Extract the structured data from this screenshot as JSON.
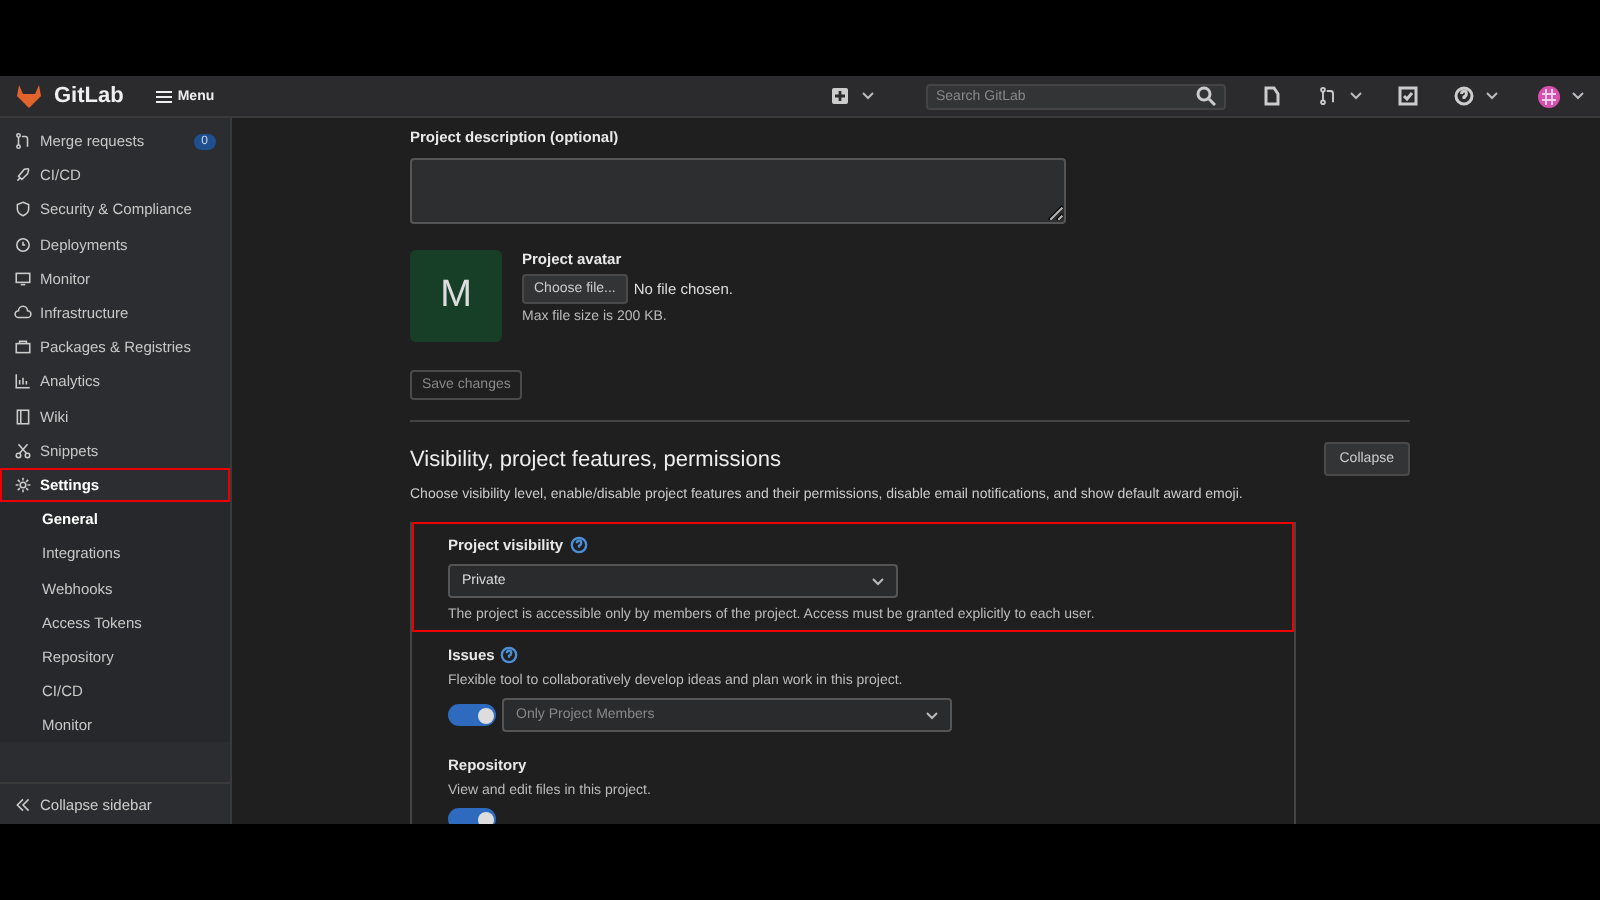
{
  "header": {
    "brand": "GitLab",
    "menu_label": "Menu",
    "search": {
      "placeholder": "Search GitLab"
    }
  },
  "sidebar": {
    "items": [
      {
        "label": "Merge requests",
        "badge": "0",
        "selected": false,
        "highlighted": false
      },
      {
        "label": "CI/CD",
        "selected": false,
        "highlighted": false
      },
      {
        "label": "Security & Compliance",
        "selected": false,
        "highlighted": false
      },
      {
        "label": "Deployments",
        "selected": false,
        "highlighted": false
      },
      {
        "label": "Monitor",
        "selected": false,
        "highlighted": false
      },
      {
        "label": "Infrastructure",
        "selected": false,
        "highlighted": false
      },
      {
        "label": "Packages & Registries",
        "selected": false,
        "highlighted": false
      },
      {
        "label": "Analytics",
        "selected": false,
        "highlighted": false
      },
      {
        "label": "Wiki",
        "selected": false,
        "highlighted": false
      },
      {
        "label": "Snippets",
        "selected": false,
        "highlighted": false
      },
      {
        "label": "Settings",
        "selected": true,
        "highlighted": true,
        "children": [
          {
            "label": "General",
            "selected": true
          },
          {
            "label": "Integrations",
            "selected": false
          },
          {
            "label": "Webhooks",
            "selected": false
          },
          {
            "label": "Access Tokens",
            "selected": false
          },
          {
            "label": "Repository",
            "selected": false
          },
          {
            "label": "CI/CD",
            "selected": false
          },
          {
            "label": "Monitor",
            "selected": false
          }
        ]
      }
    ],
    "collapse_label": "Collapse sidebar"
  },
  "general": {
    "description_label": "Project description (optional)",
    "avatar_letter": "M",
    "avatar_label": "Project avatar",
    "choose_button": "Choose file...",
    "file_status": "No file chosen.",
    "file_hint": "Max file size is 200 KB.",
    "save_button": "Save changes"
  },
  "visibility_section": {
    "title": "Visibility, project features, permissions",
    "collapse_button": "Collapse",
    "description": "Choose visibility level, enable/disable project features and their permissions, disable email notifications, and show default award emoji.",
    "features": [
      {
        "kind": "select",
        "label": "Project visibility",
        "help": true,
        "value": "Private",
        "description": "The project is accessible only by members of the project. Access must be granted explicitly to each user.",
        "highlighted": true
      },
      {
        "kind": "toggle",
        "label": "Issues",
        "help": true,
        "description": "Flexible tool to collaboratively develop ideas and plan work in this project.",
        "on": true,
        "value": "Only Project Members",
        "highlighted": false
      },
      {
        "kind": "toggle",
        "label": "Repository",
        "help": false,
        "description": "View and edit files in this project.",
        "on": true,
        "highlighted": false
      }
    ]
  }
}
